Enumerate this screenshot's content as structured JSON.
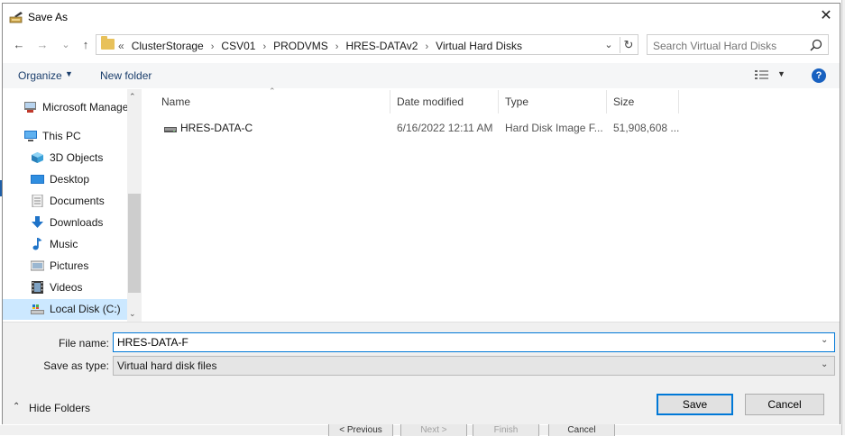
{
  "window": {
    "title": "Save As",
    "close_glyph": "✕"
  },
  "nav": {
    "back_glyph": "←",
    "forward_glyph": "→",
    "recent_glyph": "⌄",
    "up_glyph": "↑",
    "breadcrumb_prefix": "«",
    "breadcrumbs": [
      "ClusterStorage",
      "CSV01",
      "PRODVMS",
      "HRES-DATAv2",
      "Virtual Hard Disks"
    ],
    "separator": "›",
    "refresh_glyph": "↻",
    "dropdown_glyph": "⌄"
  },
  "search": {
    "placeholder": "Search Virtual Hard Disks",
    "icon": "search-icon"
  },
  "toolbar": {
    "organize_label": "Organize",
    "organize_chevron": "▼",
    "new_folder_label": "New folder",
    "views_chevron": "▼",
    "help_label": "?"
  },
  "navpane": {
    "items": [
      {
        "label": "Microsoft Management Console",
        "icon": "mmc-icon"
      },
      {
        "label": "This PC",
        "icon": "computer-icon"
      },
      {
        "label": "3D Objects",
        "icon": "cube-icon"
      },
      {
        "label": "Desktop",
        "icon": "desktop-icon"
      },
      {
        "label": "Documents",
        "icon": "document-icon"
      },
      {
        "label": "Downloads",
        "icon": "download-icon"
      },
      {
        "label": "Music",
        "icon": "music-icon"
      },
      {
        "label": "Pictures",
        "icon": "pictures-icon"
      },
      {
        "label": "Videos",
        "icon": "video-icon"
      },
      {
        "label": "Local Disk (C:)",
        "icon": "drive-icon"
      }
    ],
    "selected": "Local Disk (C:)",
    "scroll_up": "⌃",
    "scroll_down": "⌄"
  },
  "filelist": {
    "columns": [
      "Name",
      "Date modified",
      "Type",
      "Size"
    ],
    "sort_glyph": "⌃",
    "rows": [
      {
        "name": "HRES-DATA-C",
        "date": "6/16/2022 12:11 AM",
        "type": "Hard Disk Image F...",
        "size": "51,908,608 ..."
      }
    ]
  },
  "form": {
    "file_name_label": "File name:",
    "file_name_value": "HRES-DATA-F",
    "save_type_label": "Save as type:",
    "save_type_value": "Virtual hard disk files",
    "drop_glyph": "⌄"
  },
  "footer": {
    "hide_folders_label": "Hide Folders",
    "hide_chevron": "⌃",
    "save_label": "Save",
    "cancel_label": "Cancel"
  },
  "background_wizard": {
    "buttons": [
      "< Previous",
      "Next >",
      "Finish",
      "Cancel"
    ]
  },
  "colors": {
    "accent": "#0078d7",
    "link": "#1a3e6c",
    "selection": "#cce8ff",
    "panel": "#f0f0f0"
  }
}
